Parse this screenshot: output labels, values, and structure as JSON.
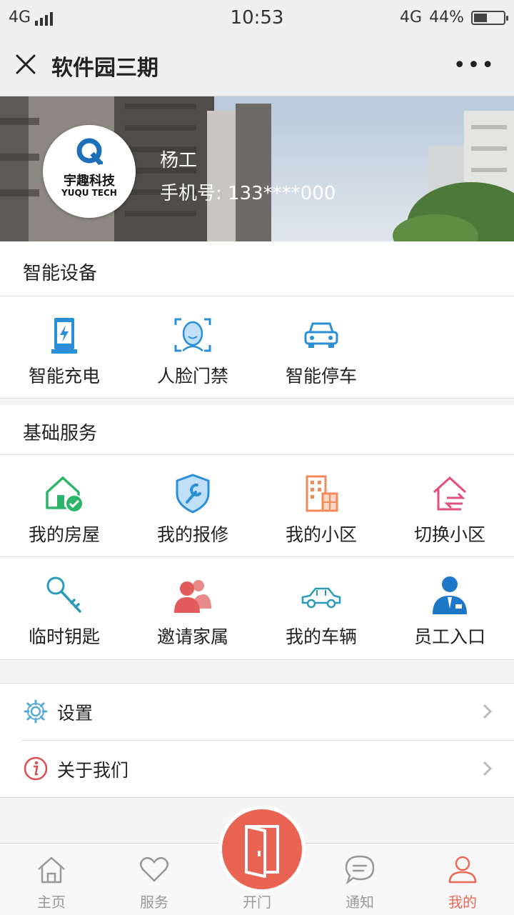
{
  "status_bar": {
    "network_left": "4G",
    "time": "10:53",
    "network_right": "4G",
    "battery_text": "44%",
    "battery_level": 0.44
  },
  "nav": {
    "title": "软件园三期"
  },
  "profile": {
    "logo_cn": "宇趣科技",
    "logo_en": "YUQU TECH",
    "name": "杨工",
    "phone": "手机号: 133****000"
  },
  "smart_devices": {
    "title": "智能设备",
    "items": [
      {
        "label": "智能充电",
        "icon": "charging-station-icon"
      },
      {
        "label": "人脸门禁",
        "icon": "face-recognition-icon"
      },
      {
        "label": "智能停车",
        "icon": "car-front-icon"
      }
    ]
  },
  "basic_services": {
    "title": "基础服务",
    "items": [
      {
        "label": "我的房屋",
        "icon": "house-check-icon"
      },
      {
        "label": "我的报修",
        "icon": "wrench-shield-icon"
      },
      {
        "label": "我的小区",
        "icon": "building-icon"
      },
      {
        "label": "切换小区",
        "icon": "house-switch-icon"
      },
      {
        "label": "临时钥匙",
        "icon": "key-icon"
      },
      {
        "label": "邀请家属",
        "icon": "family-icon"
      },
      {
        "label": "我的车辆",
        "icon": "car-side-icon"
      },
      {
        "label": "员工入口",
        "icon": "staff-icon"
      }
    ]
  },
  "menu": [
    {
      "label": "设置",
      "icon": "gear-icon"
    },
    {
      "label": "关于我们",
      "icon": "info-icon"
    }
  ],
  "tabs": [
    {
      "label": "主页",
      "icon": "home-icon"
    },
    {
      "label": "服务",
      "icon": "heart-icon"
    },
    {
      "label": "开门",
      "icon": "door-icon"
    },
    {
      "label": "通知",
      "icon": "chat-icon"
    },
    {
      "label": "我的",
      "icon": "user-icon",
      "active": true
    }
  ],
  "colors": {
    "accent": "#e86351",
    "blue": "#2a8fd6",
    "green": "#2db56a",
    "orange": "#f08a5d",
    "pink": "#e0507a"
  }
}
